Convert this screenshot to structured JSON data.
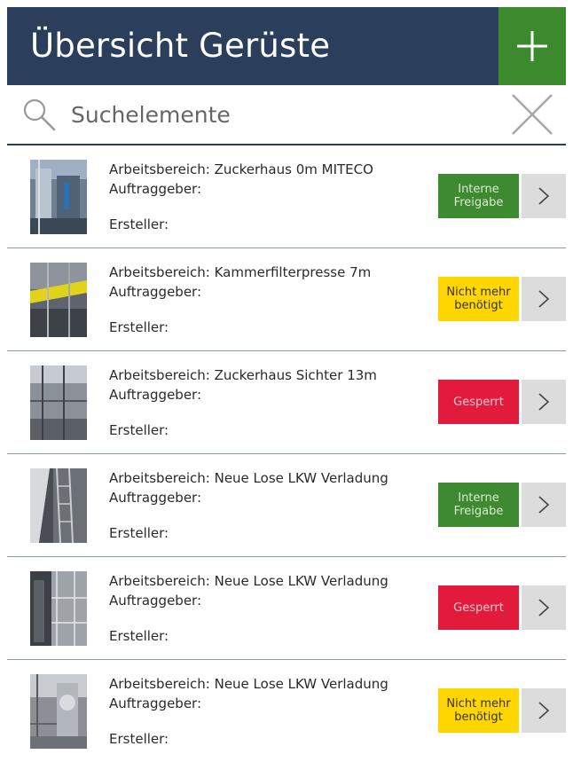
{
  "header": {
    "title": "Übersicht Gerüste",
    "add_icon": "plus-icon"
  },
  "search": {
    "placeholder": "Suchelemente",
    "search_icon": "search-icon",
    "clear_icon": "close-icon"
  },
  "colors": {
    "header_bg": "#2b3f5c",
    "add_bg": "#3b8b2e",
    "status_green": "#3d8a30",
    "status_yellow": "#ffd600",
    "status_red": "#e21b3c"
  },
  "items": [
    {
      "area": "Arbeitsbereich: Zuckerhaus 0m MITECO",
      "client": "Auftraggeber:",
      "creator": "Ersteller:",
      "status": "Interne Freigabe",
      "status_type": "green"
    },
    {
      "area": "Arbeitsbereich: Kammerfilterpresse 7m",
      "client": "Auftraggeber:",
      "creator": "Ersteller:",
      "status": "Nicht mehr benötigt",
      "status_type": "yellow"
    },
    {
      "area": "Arbeitsbereich: Zuckerhaus Sichter 13m",
      "client": "Auftraggeber:",
      "creator": "Ersteller:",
      "status": "Gesperrt",
      "status_type": "red"
    },
    {
      "area": "Arbeitsbereich: Neue Lose LKW Verladung",
      "client": "Auftraggeber:",
      "creator": "Ersteller:",
      "status": "Interne Freigabe",
      "status_type": "green"
    },
    {
      "area": "Arbeitsbereich: Neue Lose LKW Verladung",
      "client": "Auftraggeber:",
      "creator": "Ersteller:",
      "status": "Gesperrt",
      "status_type": "red"
    },
    {
      "area": "Arbeitsbereich: Neue Lose LKW Verladung",
      "client": "Auftraggeber:",
      "creator": "Ersteller:",
      "status": "Nicht mehr benötigt",
      "status_type": "yellow"
    }
  ]
}
